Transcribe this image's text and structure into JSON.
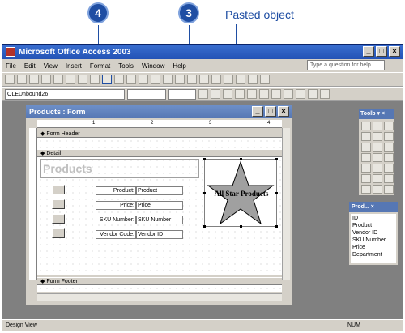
{
  "callouts": {
    "four": "4",
    "three": "3",
    "annotation": "Pasted object"
  },
  "app": {
    "title": "Microsoft Office Access 2003",
    "menu": [
      "File",
      "Edit",
      "View",
      "Insert",
      "Format",
      "Tools",
      "Window",
      "Help"
    ],
    "help_placeholder": "Type a question for help",
    "object_selector": "OLEUnbound26"
  },
  "form": {
    "title": "Products : Form",
    "sections": {
      "header": "Form Header",
      "detail": "Detail",
      "footer": "Form Footer"
    },
    "heading": "Products",
    "fields": [
      {
        "label": "Product:",
        "value": "Product"
      },
      {
        "label": "Price:",
        "value": "Price"
      },
      {
        "label": "SKU Number:",
        "value": "SKU Number"
      },
      {
        "label": "Vendor Code:",
        "value": "Vendor ID"
      }
    ],
    "pasted_text": "All Star Products",
    "ruler_marks": [
      "1",
      "2",
      "3",
      "4"
    ]
  },
  "toolbox": {
    "title": "Toolb"
  },
  "field_list": {
    "title": "Prod...",
    "items": [
      "ID",
      "Product",
      "Vendor ID",
      "SKU Number",
      "Price",
      "Department"
    ]
  },
  "status": {
    "mode": "Design View",
    "num": "NUM"
  }
}
